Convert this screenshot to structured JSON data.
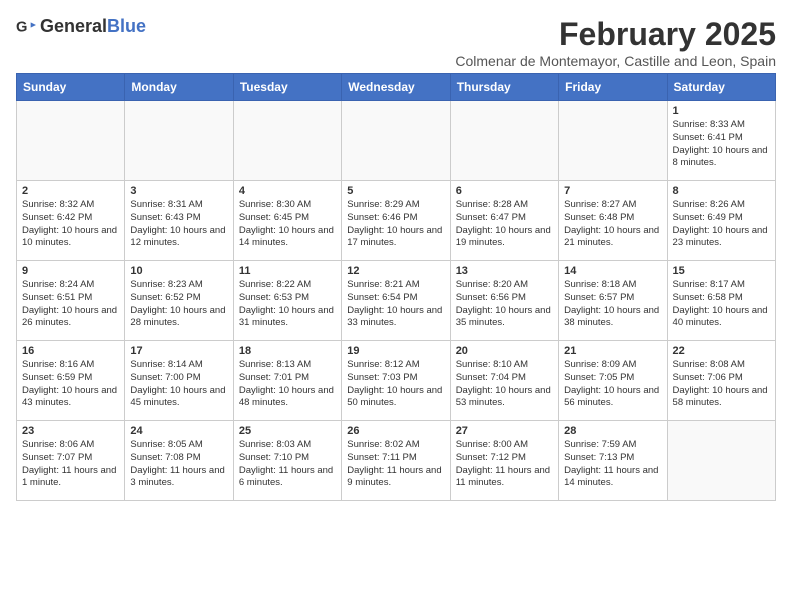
{
  "header": {
    "logo_general": "General",
    "logo_blue": "Blue",
    "main_title": "February 2025",
    "subtitle": "Colmenar de Montemayor, Castille and Leon, Spain"
  },
  "weekdays": [
    "Sunday",
    "Monday",
    "Tuesday",
    "Wednesday",
    "Thursday",
    "Friday",
    "Saturday"
  ],
  "weeks": [
    [
      {
        "day": "",
        "info": ""
      },
      {
        "day": "",
        "info": ""
      },
      {
        "day": "",
        "info": ""
      },
      {
        "day": "",
        "info": ""
      },
      {
        "day": "",
        "info": ""
      },
      {
        "day": "",
        "info": ""
      },
      {
        "day": "1",
        "info": "Sunrise: 8:33 AM\nSunset: 6:41 PM\nDaylight: 10 hours and 8 minutes."
      }
    ],
    [
      {
        "day": "2",
        "info": "Sunrise: 8:32 AM\nSunset: 6:42 PM\nDaylight: 10 hours and 10 minutes."
      },
      {
        "day": "3",
        "info": "Sunrise: 8:31 AM\nSunset: 6:43 PM\nDaylight: 10 hours and 12 minutes."
      },
      {
        "day": "4",
        "info": "Sunrise: 8:30 AM\nSunset: 6:45 PM\nDaylight: 10 hours and 14 minutes."
      },
      {
        "day": "5",
        "info": "Sunrise: 8:29 AM\nSunset: 6:46 PM\nDaylight: 10 hours and 17 minutes."
      },
      {
        "day": "6",
        "info": "Sunrise: 8:28 AM\nSunset: 6:47 PM\nDaylight: 10 hours and 19 minutes."
      },
      {
        "day": "7",
        "info": "Sunrise: 8:27 AM\nSunset: 6:48 PM\nDaylight: 10 hours and 21 minutes."
      },
      {
        "day": "8",
        "info": "Sunrise: 8:26 AM\nSunset: 6:49 PM\nDaylight: 10 hours and 23 minutes."
      }
    ],
    [
      {
        "day": "9",
        "info": "Sunrise: 8:24 AM\nSunset: 6:51 PM\nDaylight: 10 hours and 26 minutes."
      },
      {
        "day": "10",
        "info": "Sunrise: 8:23 AM\nSunset: 6:52 PM\nDaylight: 10 hours and 28 minutes."
      },
      {
        "day": "11",
        "info": "Sunrise: 8:22 AM\nSunset: 6:53 PM\nDaylight: 10 hours and 31 minutes."
      },
      {
        "day": "12",
        "info": "Sunrise: 8:21 AM\nSunset: 6:54 PM\nDaylight: 10 hours and 33 minutes."
      },
      {
        "day": "13",
        "info": "Sunrise: 8:20 AM\nSunset: 6:56 PM\nDaylight: 10 hours and 35 minutes."
      },
      {
        "day": "14",
        "info": "Sunrise: 8:18 AM\nSunset: 6:57 PM\nDaylight: 10 hours and 38 minutes."
      },
      {
        "day": "15",
        "info": "Sunrise: 8:17 AM\nSunset: 6:58 PM\nDaylight: 10 hours and 40 minutes."
      }
    ],
    [
      {
        "day": "16",
        "info": "Sunrise: 8:16 AM\nSunset: 6:59 PM\nDaylight: 10 hours and 43 minutes."
      },
      {
        "day": "17",
        "info": "Sunrise: 8:14 AM\nSunset: 7:00 PM\nDaylight: 10 hours and 45 minutes."
      },
      {
        "day": "18",
        "info": "Sunrise: 8:13 AM\nSunset: 7:01 PM\nDaylight: 10 hours and 48 minutes."
      },
      {
        "day": "19",
        "info": "Sunrise: 8:12 AM\nSunset: 7:03 PM\nDaylight: 10 hours and 50 minutes."
      },
      {
        "day": "20",
        "info": "Sunrise: 8:10 AM\nSunset: 7:04 PM\nDaylight: 10 hours and 53 minutes."
      },
      {
        "day": "21",
        "info": "Sunrise: 8:09 AM\nSunset: 7:05 PM\nDaylight: 10 hours and 56 minutes."
      },
      {
        "day": "22",
        "info": "Sunrise: 8:08 AM\nSunset: 7:06 PM\nDaylight: 10 hours and 58 minutes."
      }
    ],
    [
      {
        "day": "23",
        "info": "Sunrise: 8:06 AM\nSunset: 7:07 PM\nDaylight: 11 hours and 1 minute."
      },
      {
        "day": "24",
        "info": "Sunrise: 8:05 AM\nSunset: 7:08 PM\nDaylight: 11 hours and 3 minutes."
      },
      {
        "day": "25",
        "info": "Sunrise: 8:03 AM\nSunset: 7:10 PM\nDaylight: 11 hours and 6 minutes."
      },
      {
        "day": "26",
        "info": "Sunrise: 8:02 AM\nSunset: 7:11 PM\nDaylight: 11 hours and 9 minutes."
      },
      {
        "day": "27",
        "info": "Sunrise: 8:00 AM\nSunset: 7:12 PM\nDaylight: 11 hours and 11 minutes."
      },
      {
        "day": "28",
        "info": "Sunrise: 7:59 AM\nSunset: 7:13 PM\nDaylight: 11 hours and 14 minutes."
      },
      {
        "day": "",
        "info": ""
      }
    ]
  ]
}
